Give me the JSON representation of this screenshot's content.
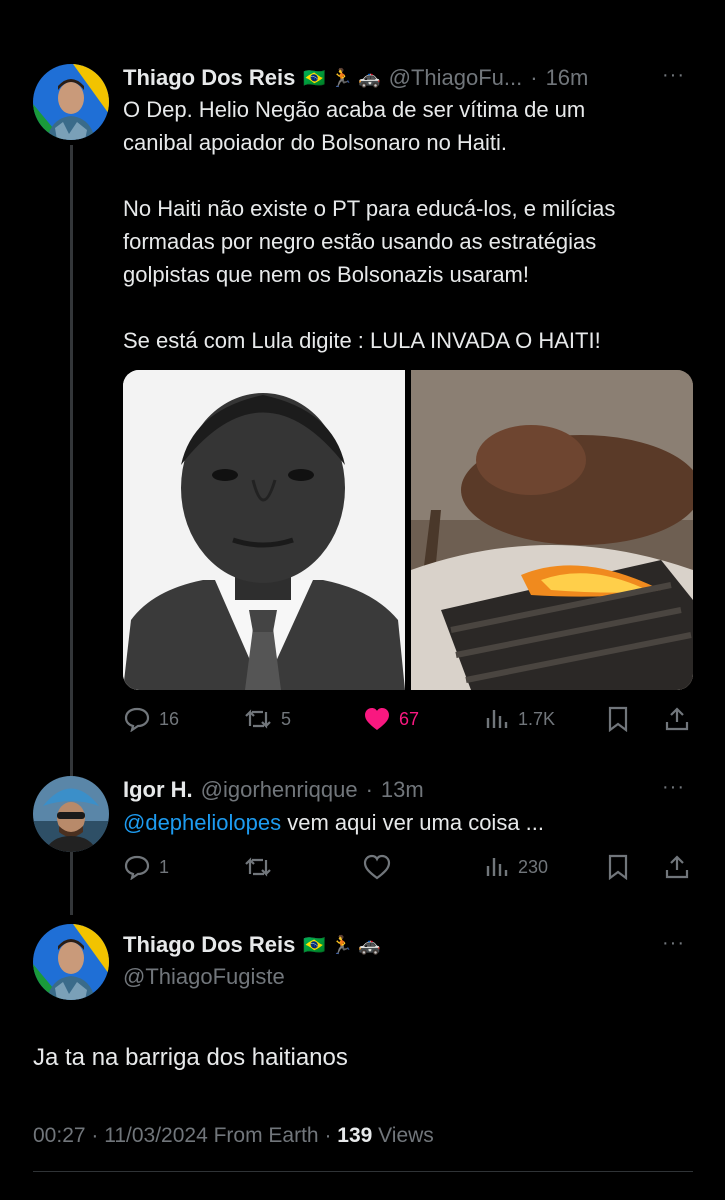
{
  "tweet1": {
    "name": "Thiago Dos Reis",
    "emojis": "🇧🇷 🏃 🚓",
    "handle": "@ThiagoFu...",
    "dot": "·",
    "time": "16m",
    "more": "···",
    "text_line1": "O Dep. Helio Negão acaba de ser vítima de um",
    "text_line2": "canibal apoiador do Bolsonaro no Haiti.",
    "text_line3": "No Haiti não existe o PT para educá-los, e milícias",
    "text_line4": "formadas por negro estão usando as estratégias",
    "text_line5": "golpistas que nem os Bolsonazis usaram!",
    "text_line6": "Se está com Lula digite : LULA INVADA O HAITI!",
    "replies": "16",
    "retweets": "5",
    "likes": "67",
    "views": "1.7K"
  },
  "tweet2": {
    "name": "Igor H.",
    "handle": "@igorhenriqque",
    "dot": "·",
    "time": "13m",
    "more": "···",
    "mention": "@depheliolopes",
    "text": " vem aqui ver uma coisa ...",
    "replies": "1",
    "views": "230"
  },
  "tweet3": {
    "name": "Thiago Dos Reis",
    "emojis": "🇧🇷 🏃 🚓",
    "handle": "@ThiagoFugiste",
    "more": "···",
    "text": "Ja ta na barriga dos haitianos",
    "timestamp": "00:27 · 11/03/2024 From Earth · ",
    "views_count": "139",
    "views_label": " Views"
  },
  "colors": {
    "background": "#000000",
    "text": "#e7e9ea",
    "secondary": "#71767b",
    "link": "#1d9bf0",
    "like": "#f91880"
  }
}
